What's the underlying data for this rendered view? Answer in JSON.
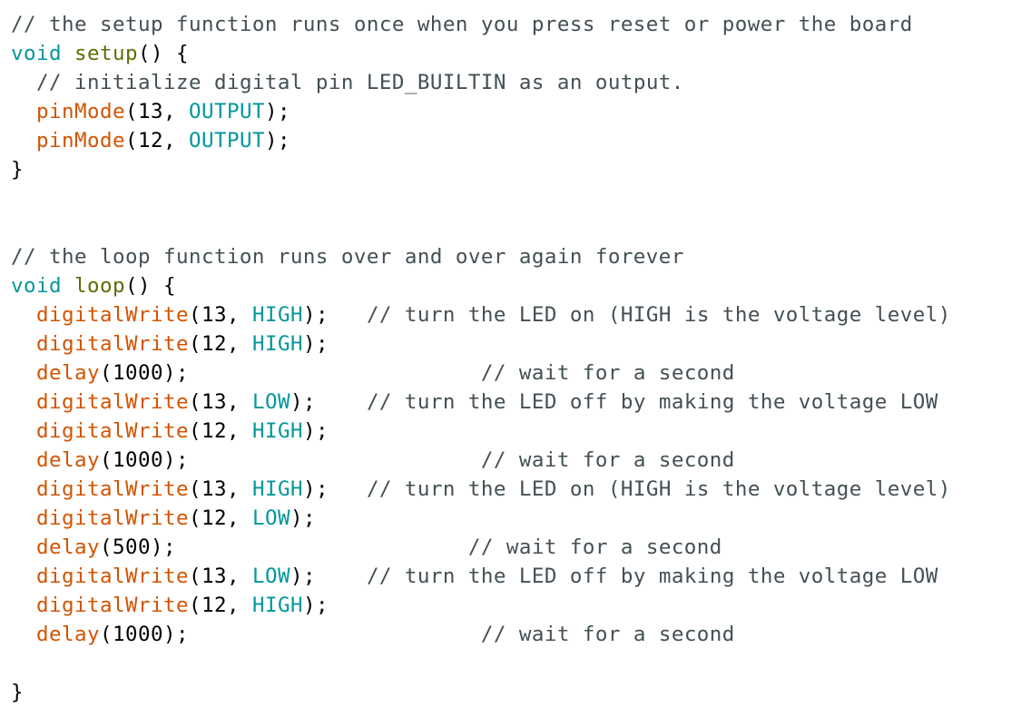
{
  "colors": {
    "background": "#ffffff",
    "comment": "#434f54",
    "keyword": "#00979c",
    "function": "#d35400",
    "define": "#5e6d03",
    "constant": "#00979c",
    "plain": "#000000"
  },
  "code": {
    "lines": [
      [
        {
          "t": "comment",
          "s": "// the setup function runs once when you press reset or power the board"
        }
      ],
      [
        {
          "t": "keyword",
          "s": "void"
        },
        {
          "t": "plain",
          "s": " "
        },
        {
          "t": "define",
          "s": "setup"
        },
        {
          "t": "plain",
          "s": "() {"
        }
      ],
      [
        {
          "t": "plain",
          "s": "  "
        },
        {
          "t": "comment",
          "s": "// initialize digital pin LED_BUILTIN as an output."
        }
      ],
      [
        {
          "t": "plain",
          "s": "  "
        },
        {
          "t": "function",
          "s": "pinMode"
        },
        {
          "t": "plain",
          "s": "(13, "
        },
        {
          "t": "constant",
          "s": "OUTPUT"
        },
        {
          "t": "plain",
          "s": ");"
        }
      ],
      [
        {
          "t": "plain",
          "s": "  "
        },
        {
          "t": "function",
          "s": "pinMode"
        },
        {
          "t": "plain",
          "s": "(12, "
        },
        {
          "t": "constant",
          "s": "OUTPUT"
        },
        {
          "t": "plain",
          "s": ");"
        }
      ],
      [
        {
          "t": "plain",
          "s": "}"
        }
      ],
      [],
      [],
      [
        {
          "t": "comment",
          "s": "// the loop function runs over and over again forever"
        }
      ],
      [
        {
          "t": "keyword",
          "s": "void"
        },
        {
          "t": "plain",
          "s": " "
        },
        {
          "t": "define",
          "s": "loop"
        },
        {
          "t": "plain",
          "s": "() {"
        }
      ],
      [
        {
          "t": "plain",
          "s": "  "
        },
        {
          "t": "function",
          "s": "digitalWrite"
        },
        {
          "t": "plain",
          "s": "(13, "
        },
        {
          "t": "constant",
          "s": "HIGH"
        },
        {
          "t": "plain",
          "s": ");   "
        },
        {
          "t": "comment",
          "s": "// turn the LED on (HIGH is the voltage level)"
        }
      ],
      [
        {
          "t": "plain",
          "s": "  "
        },
        {
          "t": "function",
          "s": "digitalWrite"
        },
        {
          "t": "plain",
          "s": "(12, "
        },
        {
          "t": "constant",
          "s": "HIGH"
        },
        {
          "t": "plain",
          "s": ");"
        }
      ],
      [
        {
          "t": "plain",
          "s": "  "
        },
        {
          "t": "function",
          "s": "delay"
        },
        {
          "t": "plain",
          "s": "(1000);                       "
        },
        {
          "t": "comment",
          "s": "// wait for a second"
        }
      ],
      [
        {
          "t": "plain",
          "s": "  "
        },
        {
          "t": "function",
          "s": "digitalWrite"
        },
        {
          "t": "plain",
          "s": "(13, "
        },
        {
          "t": "constant",
          "s": "LOW"
        },
        {
          "t": "plain",
          "s": ");    "
        },
        {
          "t": "comment",
          "s": "// turn the LED off by making the voltage LOW"
        }
      ],
      [
        {
          "t": "plain",
          "s": "  "
        },
        {
          "t": "function",
          "s": "digitalWrite"
        },
        {
          "t": "plain",
          "s": "(12, "
        },
        {
          "t": "constant",
          "s": "HIGH"
        },
        {
          "t": "plain",
          "s": ");"
        }
      ],
      [
        {
          "t": "plain",
          "s": "  "
        },
        {
          "t": "function",
          "s": "delay"
        },
        {
          "t": "plain",
          "s": "(1000);                       "
        },
        {
          "t": "comment",
          "s": "// wait for a second"
        }
      ],
      [
        {
          "t": "plain",
          "s": "  "
        },
        {
          "t": "function",
          "s": "digitalWrite"
        },
        {
          "t": "plain",
          "s": "(13, "
        },
        {
          "t": "constant",
          "s": "HIGH"
        },
        {
          "t": "plain",
          "s": ");   "
        },
        {
          "t": "comment",
          "s": "// turn the LED on (HIGH is the voltage level)"
        }
      ],
      [
        {
          "t": "plain",
          "s": "  "
        },
        {
          "t": "function",
          "s": "digitalWrite"
        },
        {
          "t": "plain",
          "s": "(12, "
        },
        {
          "t": "constant",
          "s": "LOW"
        },
        {
          "t": "plain",
          "s": ");"
        }
      ],
      [
        {
          "t": "plain",
          "s": "  "
        },
        {
          "t": "function",
          "s": "delay"
        },
        {
          "t": "plain",
          "s": "(500);                       "
        },
        {
          "t": "comment",
          "s": "// wait for a second"
        }
      ],
      [
        {
          "t": "plain",
          "s": "  "
        },
        {
          "t": "function",
          "s": "digitalWrite"
        },
        {
          "t": "plain",
          "s": "(13, "
        },
        {
          "t": "constant",
          "s": "LOW"
        },
        {
          "t": "plain",
          "s": ");    "
        },
        {
          "t": "comment",
          "s": "// turn the LED off by making the voltage LOW"
        }
      ],
      [
        {
          "t": "plain",
          "s": "  "
        },
        {
          "t": "function",
          "s": "digitalWrite"
        },
        {
          "t": "plain",
          "s": "(12, "
        },
        {
          "t": "constant",
          "s": "HIGH"
        },
        {
          "t": "plain",
          "s": ");"
        }
      ],
      [
        {
          "t": "plain",
          "s": "  "
        },
        {
          "t": "function",
          "s": "delay"
        },
        {
          "t": "plain",
          "s": "(1000);                       "
        },
        {
          "t": "comment",
          "s": "// wait for a second"
        }
      ],
      [],
      [
        {
          "t": "plain",
          "s": "}"
        }
      ]
    ]
  }
}
